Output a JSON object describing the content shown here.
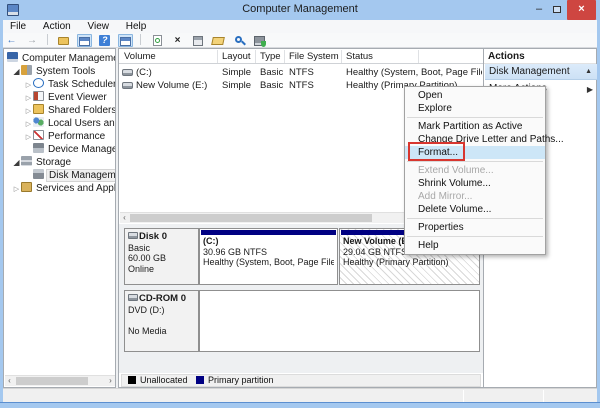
{
  "window": {
    "title": "Computer Management",
    "controls": {
      "minimize": "–",
      "close": "×"
    }
  },
  "menubar": {
    "file": "File",
    "action": "Action",
    "view": "View",
    "help": "Help"
  },
  "toolbar": {
    "icons": [
      "back-icon",
      "forward-icon",
      "folder-icon",
      "console-tree-icon",
      "help-icon",
      "action-pane-icon",
      "refresh-icon",
      "delete-icon",
      "properties-icon",
      "open-folder-icon",
      "find-icon",
      "security-icon"
    ],
    "back_glyph": "←",
    "forward_glyph": "→",
    "help_glyph": "?",
    "delete_glyph": "×"
  },
  "tree": {
    "items": [
      {
        "label": "Computer Management (Local",
        "icon": "computer-management-icon",
        "level": 0,
        "expander": "none",
        "selected": false
      },
      {
        "label": "System Tools",
        "icon": "system-tools-icon",
        "level": 1,
        "expander": "expanded",
        "selected": false
      },
      {
        "label": "Task Scheduler",
        "icon": "task-scheduler-icon",
        "level": 2,
        "expander": "collapsed",
        "selected": false
      },
      {
        "label": "Event Viewer",
        "icon": "event-viewer-icon",
        "level": 2,
        "expander": "collapsed",
        "selected": false
      },
      {
        "label": "Shared Folders",
        "icon": "shared-folders-icon",
        "level": 2,
        "expander": "collapsed",
        "selected": false
      },
      {
        "label": "Local Users and Groups",
        "icon": "local-users-groups-icon",
        "level": 2,
        "expander": "collapsed",
        "selected": false
      },
      {
        "label": "Performance",
        "icon": "performance-icon",
        "level": 2,
        "expander": "collapsed",
        "selected": false
      },
      {
        "label": "Device Manager",
        "icon": "device-manager-icon",
        "level": 2,
        "expander": "none",
        "selected": false
      },
      {
        "label": "Storage",
        "icon": "storage-icon",
        "level": 1,
        "expander": "expanded",
        "selected": false
      },
      {
        "label": "Disk Management",
        "icon": "disk-management-icon",
        "level": 2,
        "expander": "none",
        "selected": true
      },
      {
        "label": "Services and Applications",
        "icon": "services-applications-icon",
        "level": 1,
        "expander": "collapsed",
        "selected": false
      }
    ],
    "expanded_glyph": "◢",
    "collapsed_glyph": "▷"
  },
  "volume_list": {
    "headers": {
      "volume": "Volume",
      "layout": "Layout",
      "type": "Type",
      "fs": "File System",
      "status": "Status"
    },
    "rows": [
      {
        "volume": "(C:)",
        "layout": "Simple",
        "type": "Basic",
        "fs": "NTFS",
        "status": "Healthy (System, Boot, Page File, Active, Crash Dump, Prima"
      },
      {
        "volume": "New Volume (E:)",
        "layout": "Simple",
        "type": "Basic",
        "fs": "NTFS",
        "status": "Healthy (Primary Partition)"
      }
    ]
  },
  "actions_pane": {
    "title": "Actions",
    "section_header": "Disk Management",
    "collapse_glyph": "▲",
    "more_actions": "More Actions",
    "more_glyph": "▶"
  },
  "context_menu": {
    "open": "Open",
    "explore": "Explore",
    "mark_active": "Mark Partition as Active",
    "change_letter": "Change Drive Letter and Paths...",
    "format": "Format...",
    "extend": "Extend Volume...",
    "shrink": "Shrink Volume...",
    "add_mirror": "Add Mirror...",
    "delete": "Delete Volume...",
    "properties": "Properties",
    "help": "Help"
  },
  "disks": {
    "disk0": {
      "name": "Disk 0",
      "type": "Basic",
      "size": "60.00 GB",
      "status": "Online",
      "partitions": [
        {
          "name": "(C:)",
          "size_fs": "30.96 GB NTFS",
          "status": "Healthy (System, Boot, Page File, Active, Cr",
          "selected": false
        },
        {
          "name": "New Volume  (E:)",
          "size_fs": "29.04 GB NTFS",
          "status": "Healthy (Primary Partition)",
          "selected": true
        }
      ]
    },
    "cdrom0": {
      "name": "CD-ROM 0",
      "type": "DVD (D:)",
      "status": "No Media"
    }
  },
  "legend": {
    "unallocated": "Unallocated",
    "primary": "Primary partition",
    "colors": {
      "unallocated": "#000000",
      "primary": "#000082"
    }
  },
  "colors": {
    "titlebar": "#a4c8ef",
    "close_button": "#ce4641",
    "partition_bar": "#000082",
    "menu_highlight": "#cde6f7",
    "annotation_red": "#d8362f",
    "actions_selected": "#d6e7f8"
  }
}
